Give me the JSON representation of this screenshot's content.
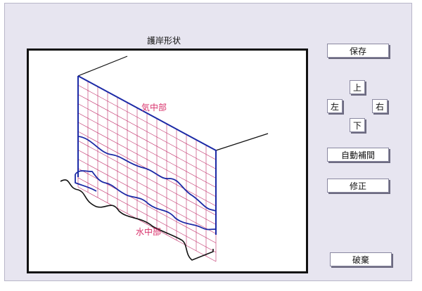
{
  "panel": {
    "title": "護岸形状"
  },
  "canvas": {
    "label_above_water": "気中部",
    "label_under_water": "水中部",
    "label_color": "#d8306a",
    "outline_color": "#1c2aa6",
    "grid_color": "#c0306a"
  },
  "buttons": {
    "save": "保存",
    "up": "上",
    "left": "左",
    "right": "右",
    "down": "下",
    "auto_interpolate": "自動補間",
    "modify": "修正",
    "discard": "破棄"
  }
}
